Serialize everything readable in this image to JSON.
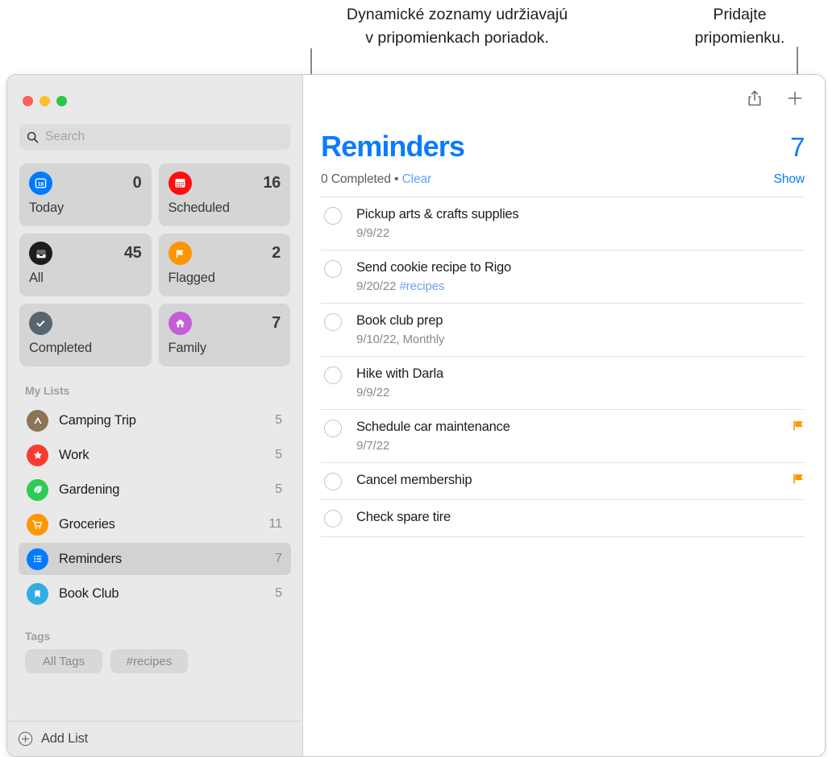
{
  "callouts": {
    "left": "Dynamické zoznamy udržiavajú\nv pripomienkach poriadok.",
    "right": "Pridajte\npripomienku."
  },
  "sidebar": {
    "search": {
      "placeholder": "Search",
      "value": ""
    },
    "smart_lists": [
      {
        "label": "Today",
        "count": "0",
        "icon": "calendar-day-icon",
        "color": "#007aff"
      },
      {
        "label": "Scheduled",
        "count": "16",
        "icon": "calendar-icon",
        "color": "#ff0f0f"
      },
      {
        "label": "All",
        "count": "45",
        "icon": "inbox-icon",
        "color": "#1d1d1f"
      },
      {
        "label": "Flagged",
        "count": "2",
        "icon": "flag-icon",
        "color": "#ff9500"
      },
      {
        "label": "Completed",
        "count": "",
        "icon": "checkmark-icon",
        "color": "#58656f"
      },
      {
        "label": "Family",
        "count": "7",
        "icon": "house-icon",
        "color": "#c45ed6"
      }
    ],
    "my_lists_header": "My Lists",
    "my_lists": [
      {
        "label": "Camping Trip",
        "count": "5",
        "icon": "tent-icon",
        "color": "#8a7556",
        "selected": false
      },
      {
        "label": "Work",
        "count": "5",
        "icon": "star-icon",
        "color": "#fc3b30",
        "selected": false
      },
      {
        "label": "Gardening",
        "count": "5",
        "icon": "leaf-icon",
        "color": "#2ecb55",
        "selected": false
      },
      {
        "label": "Groceries",
        "count": "11",
        "icon": "cart-icon",
        "color": "#ff9500",
        "selected": false
      },
      {
        "label": "Reminders",
        "count": "7",
        "icon": "list-icon",
        "color": "#007aff",
        "selected": true
      },
      {
        "label": "Book Club",
        "count": "5",
        "icon": "bookmark-icon",
        "color": "#31ade4",
        "selected": false
      }
    ],
    "tags_header": "Tags",
    "tags": [
      {
        "label": "All Tags"
      },
      {
        "label": "#recipes"
      }
    ],
    "footer": {
      "add_list_label": "Add List",
      "add_icon": "plus-circle-icon"
    }
  },
  "content": {
    "toolbar": {
      "share_label": "Share",
      "share_icon": "share-icon",
      "add_label": "Add Reminder",
      "add_icon": "plus-icon"
    },
    "title": "Reminders",
    "total": "7",
    "completed_text": "0 Completed",
    "separator": "•",
    "clear_label": "Clear",
    "show_label": "Show",
    "accent_color": "#0b7bff",
    "reminders": [
      {
        "title": "Pickup arts & crafts supplies",
        "date": "9/9/22",
        "tag": "",
        "extra": "",
        "flagged": false
      },
      {
        "title": "Send cookie recipe to Rigo",
        "date": "9/20/22",
        "tag": "#recipes",
        "extra": "",
        "flagged": false
      },
      {
        "title": "Book club prep",
        "date": "9/10/22,",
        "tag": "",
        "extra": "Monthly",
        "flagged": false
      },
      {
        "title": "Hike with Darla",
        "date": "9/9/22",
        "tag": "",
        "extra": "",
        "flagged": false
      },
      {
        "title": "Schedule car maintenance",
        "date": "9/7/22",
        "tag": "",
        "extra": "",
        "flagged": true
      },
      {
        "title": "Cancel membership",
        "date": "",
        "tag": "",
        "extra": "",
        "flagged": true
      },
      {
        "title": "Check spare tire",
        "date": "",
        "tag": "",
        "extra": "",
        "flagged": false
      }
    ]
  }
}
